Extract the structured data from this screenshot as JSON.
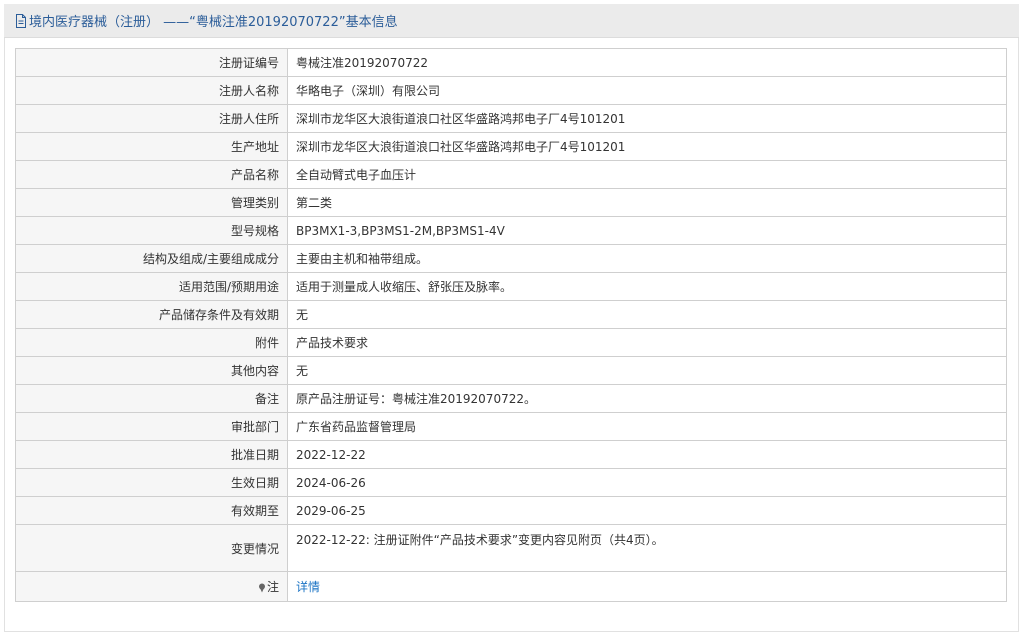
{
  "header": {
    "icon": "document-icon",
    "title": "境内医疗器械（注册） ——“粤械注准20192070722”基本信息"
  },
  "rows": [
    {
      "label": "注册证编号",
      "value": "粤械注准20192070722"
    },
    {
      "label": "注册人名称",
      "value": "华略电子（深圳）有限公司"
    },
    {
      "label": "注册人住所",
      "value": "深圳市龙华区大浪街道浪口社区华盛路鸿邦电子厂4号101201"
    },
    {
      "label": "生产地址",
      "value": "深圳市龙华区大浪街道浪口社区华盛路鸿邦电子厂4号101201"
    },
    {
      "label": "产品名称",
      "value": "全自动臂式电子血压计"
    },
    {
      "label": "管理类别",
      "value": "第二类"
    },
    {
      "label": "型号规格",
      "value": "BP3MX1-3,BP3MS1-2M,BP3MS1-4V"
    },
    {
      "label": "结构及组成/主要组成成分",
      "value": "主要由主机和袖带组成。"
    },
    {
      "label": "适用范围/预期用途",
      "value": "适用于测量成人收缩压、舒张压及脉率。"
    },
    {
      "label": "产品储存条件及有效期",
      "value": "无"
    },
    {
      "label": "附件",
      "value": "产品技术要求"
    },
    {
      "label": "其他内容",
      "value": "无"
    },
    {
      "label": "备注",
      "value": "原产品注册证号：粤械注准20192070722。"
    },
    {
      "label": "审批部门",
      "value": "广东省药品监督管理局"
    },
    {
      "label": "批准日期",
      "value": "2022-12-22"
    },
    {
      "label": "生效日期",
      "value": "2024-06-26"
    },
    {
      "label": "有效期至",
      "value": "2029-06-25"
    },
    {
      "label": "变更情况",
      "value": "2022-12-22: 注册证附件“产品技术要求”变更内容见附页（共4页）。"
    }
  ],
  "note": {
    "icon": "pin-icon",
    "label": "注",
    "link_text": "详情"
  },
  "colors": {
    "title_text": "#2b5d99",
    "link": "#1a73c4",
    "label_bg": "#f6f6f6",
    "border": "#cfcfcf"
  }
}
